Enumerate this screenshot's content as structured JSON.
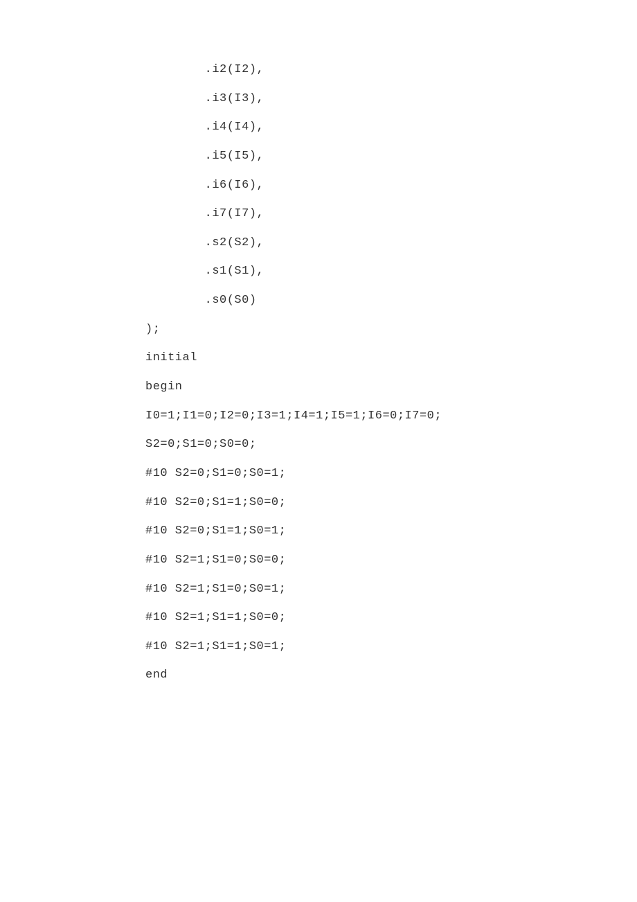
{
  "lines": [
    "        .i2(I2),",
    "        .i3(I3),",
    "        .i4(I4),",
    "        .i5(I5),",
    "        .i6(I6),",
    "        .i7(I7),",
    "        .s2(S2),",
    "        .s1(S1),",
    "        .s0(S0)",
    ");",
    "",
    "initial",
    "begin",
    "I0=1;I1=0;I2=0;I3=1;I4=1;I5=1;I6=0;I7=0;",
    "",
    "S2=0;S1=0;S0=0;",
    "#10 S2=0;S1=0;S0=1;",
    "#10 S2=0;S1=1;S0=0;",
    "#10 S2=0;S1=1;S0=1;",
    "#10 S2=1;S1=0;S0=0;",
    "#10 S2=1;S1=0;S0=1;",
    "#10 S2=1;S1=1;S0=0;",
    "#10 S2=1;S1=1;S0=1;",
    "end"
  ]
}
